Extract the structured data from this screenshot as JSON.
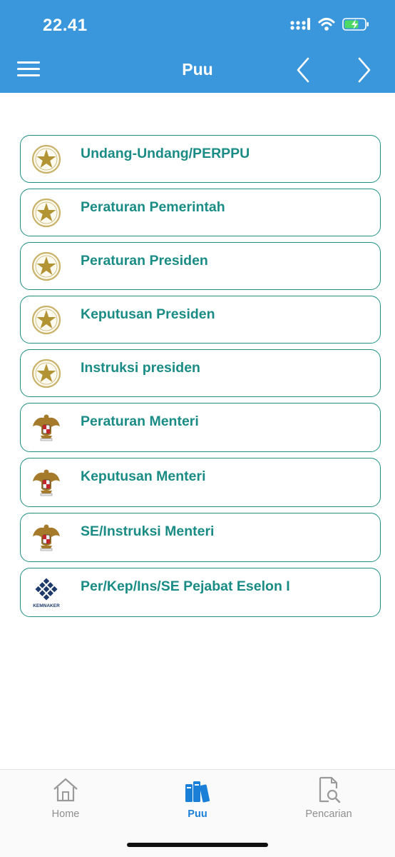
{
  "status": {
    "time": "22.41"
  },
  "header": {
    "title": "Puu"
  },
  "items": [
    {
      "label": "Undang-Undang/PERPPU",
      "logo": "star-emblem-icon"
    },
    {
      "label": "Peraturan Pemerintah",
      "logo": "star-emblem-icon"
    },
    {
      "label": "Peraturan Presiden",
      "logo": "star-emblem-icon"
    },
    {
      "label": "Keputusan Presiden",
      "logo": "star-emblem-icon"
    },
    {
      "label": "Instruksi presiden",
      "logo": "star-emblem-icon"
    },
    {
      "label": "Peraturan Menteri",
      "logo": "garuda-emblem-icon"
    },
    {
      "label": "Keputusan Menteri",
      "logo": "garuda-emblem-icon"
    },
    {
      "label": "SE/Instruksi Menteri",
      "logo": "garuda-emblem-icon"
    },
    {
      "label": "Per/Kep/Ins/SE Pejabat Eselon I",
      "logo": "kemnaker-logo",
      "logo_text": "KEMNAKER"
    }
  ],
  "tabs": [
    {
      "label": "Home",
      "icon": "home-icon",
      "active": false
    },
    {
      "label": "Puu",
      "icon": "books-icon",
      "active": true
    },
    {
      "label": "Pencarian",
      "icon": "document-search-icon",
      "active": false
    }
  ],
  "colors": {
    "header": "#3b97dc",
    "accent": "#1a8c85",
    "tab_active": "#1a7fd6",
    "tab_inactive": "#8f8f8f"
  }
}
